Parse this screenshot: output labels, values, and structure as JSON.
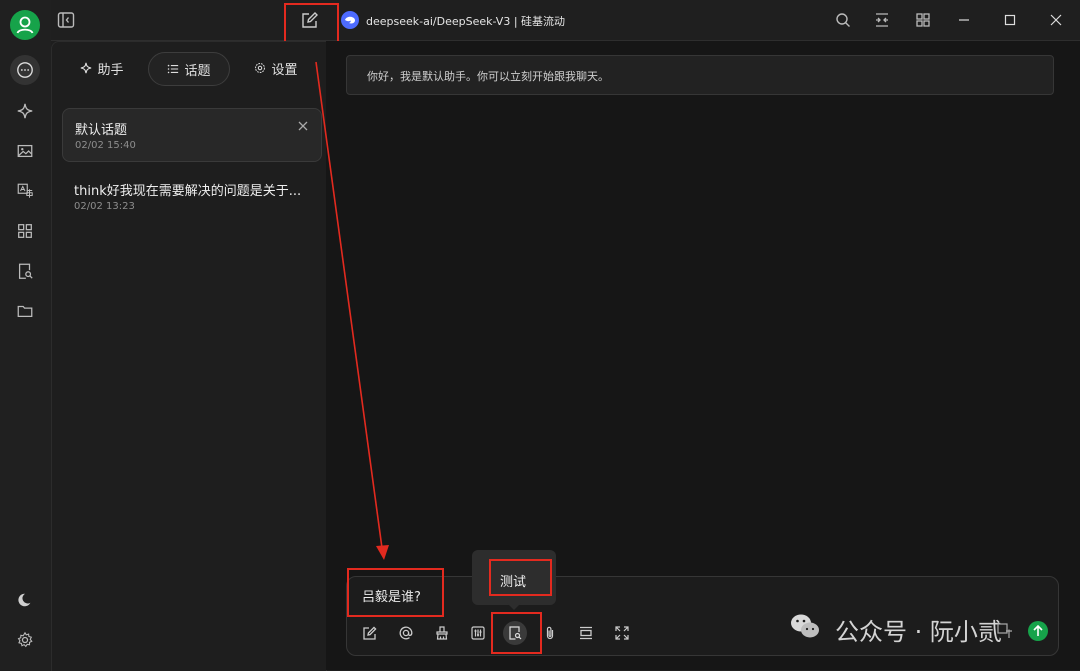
{
  "window": {
    "title": "deepseek-ai/DeepSeek-V3 | 硅基流动"
  },
  "tabs": [
    {
      "label": "助手",
      "icon": "sparkle-icon"
    },
    {
      "label": "话题",
      "icon": "list-icon"
    },
    {
      "label": "设置",
      "icon": "gear-icon"
    }
  ],
  "topics": [
    {
      "title": "默认话题",
      "time": "02/02 15:40"
    },
    {
      "title": "think好我现在需要解决的问题是关于...",
      "time": "02/02 13:23"
    }
  ],
  "chat": {
    "greeting": "你好，我是默认助手。你可以立刻开始跟我聊天。",
    "input_value": "吕毅是谁?"
  },
  "tooltip": "测试",
  "watermark": "公众号 · 阮小贰",
  "colors": {
    "accent": "#16a34a",
    "annotation_red": "#e32a1f",
    "logo_blue": "#4d6bfe"
  }
}
